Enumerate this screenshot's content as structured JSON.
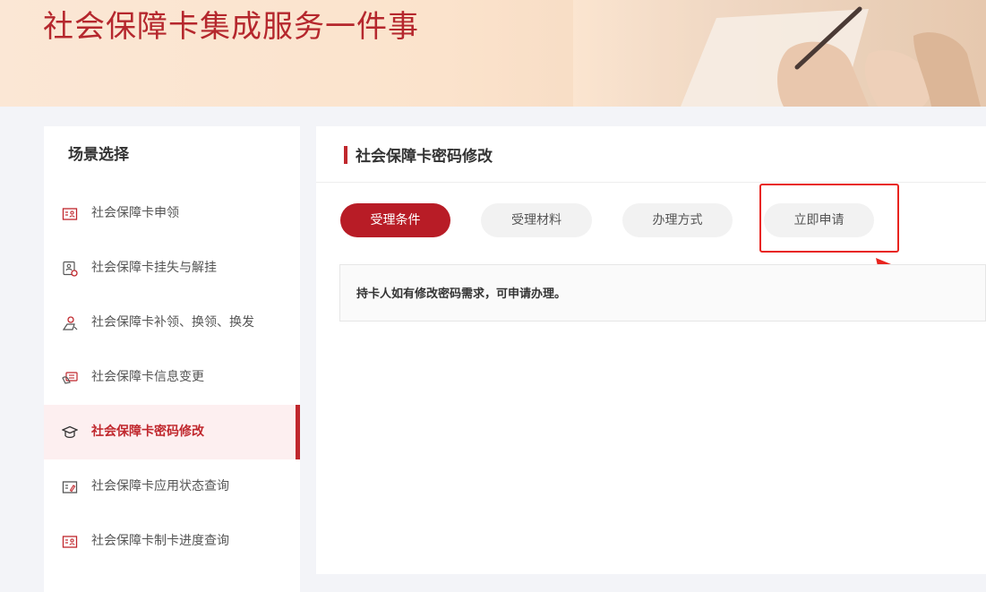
{
  "banner": {
    "title": "社会保障卡集成服务一件事"
  },
  "sidebar": {
    "title": "场景选择",
    "items": [
      {
        "label": "社会保障卡申领",
        "icon": "form-icon",
        "active": false
      },
      {
        "label": "社会保障卡挂失与解挂",
        "icon": "id-card-lock-icon",
        "active": false
      },
      {
        "label": "社会保障卡补领、换领、换发",
        "icon": "user-replace-icon",
        "active": false
      },
      {
        "label": "社会保障卡信息变更",
        "icon": "card-edit-icon",
        "active": false
      },
      {
        "label": "社会保障卡密码修改",
        "icon": "password-icon",
        "active": true
      },
      {
        "label": "社会保障卡应用状态查询",
        "icon": "status-query-icon",
        "active": false
      },
      {
        "label": "社会保障卡制卡进度查询",
        "icon": "progress-query-icon",
        "active": false
      }
    ]
  },
  "main": {
    "title": "社会保障卡密码修改",
    "tabs": [
      {
        "label": "受理条件",
        "active": true
      },
      {
        "label": "受理材料",
        "active": false
      },
      {
        "label": "办理方式",
        "active": false
      },
      {
        "label": "立即申请",
        "active": false
      }
    ],
    "content": "持卡人如有修改密码需求，可申请办理。"
  },
  "colors": {
    "accent": "#c0272d",
    "active_tab_bg": "#b81c26",
    "highlight_box": "#e8241e",
    "banner_bg": "#fbe3cc",
    "page_bg": "#f3f4f8"
  }
}
